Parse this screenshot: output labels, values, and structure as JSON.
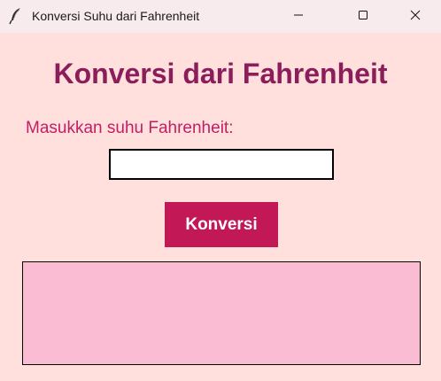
{
  "window": {
    "title": "Konversi Suhu dari Fahrenheit",
    "controls": [
      "minimize-icon",
      "maximize-icon",
      "close-icon"
    ]
  },
  "main": {
    "title": "Konversi dari Fahrenheit",
    "input_label": "Masukkan suhu Fahrenheit:",
    "input_value": "",
    "convert_label": "Konversi",
    "result_text": ""
  },
  "colors": {
    "background": "#ffe0dd",
    "title": "#8b1d5a",
    "label": "#c21f62",
    "button": "#c21856",
    "result_box": "#f9bcd2"
  }
}
